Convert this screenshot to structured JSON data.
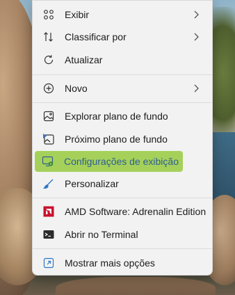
{
  "context_menu": {
    "items": [
      {
        "label": "Exibir",
        "icon": "grid-view-icon",
        "has_submenu": true
      },
      {
        "label": "Classificar por",
        "icon": "sort-icon",
        "has_submenu": true
      },
      {
        "label": "Atualizar",
        "icon": "refresh-icon",
        "has_submenu": false
      },
      {
        "label": "Novo",
        "icon": "add-circle-icon",
        "has_submenu": true
      },
      {
        "label": "Explorar plano de fundo",
        "icon": "image-icon",
        "has_submenu": false
      },
      {
        "label": "Próximo plano de fundo",
        "icon": "next-wallpaper-icon",
        "has_submenu": false
      },
      {
        "label": "Configurações de exibição",
        "icon": "display-settings-icon",
        "has_submenu": false,
        "highlighted": true
      },
      {
        "label": "Personalizar",
        "icon": "brush-icon",
        "has_submenu": false
      },
      {
        "label": "AMD Software: Adrenalin Edition",
        "icon": "amd-logo-icon",
        "has_submenu": false
      },
      {
        "label": "Abrir no Terminal",
        "icon": "terminal-icon",
        "has_submenu": false
      },
      {
        "label": "Mostrar mais opções",
        "icon": "more-options-icon",
        "has_submenu": false
      }
    ]
  },
  "colors": {
    "menu_background": "#f2f2f2",
    "highlight": "#a5d15a",
    "highlight_text": "#2f5e92",
    "amd_red": "#c8102e"
  }
}
